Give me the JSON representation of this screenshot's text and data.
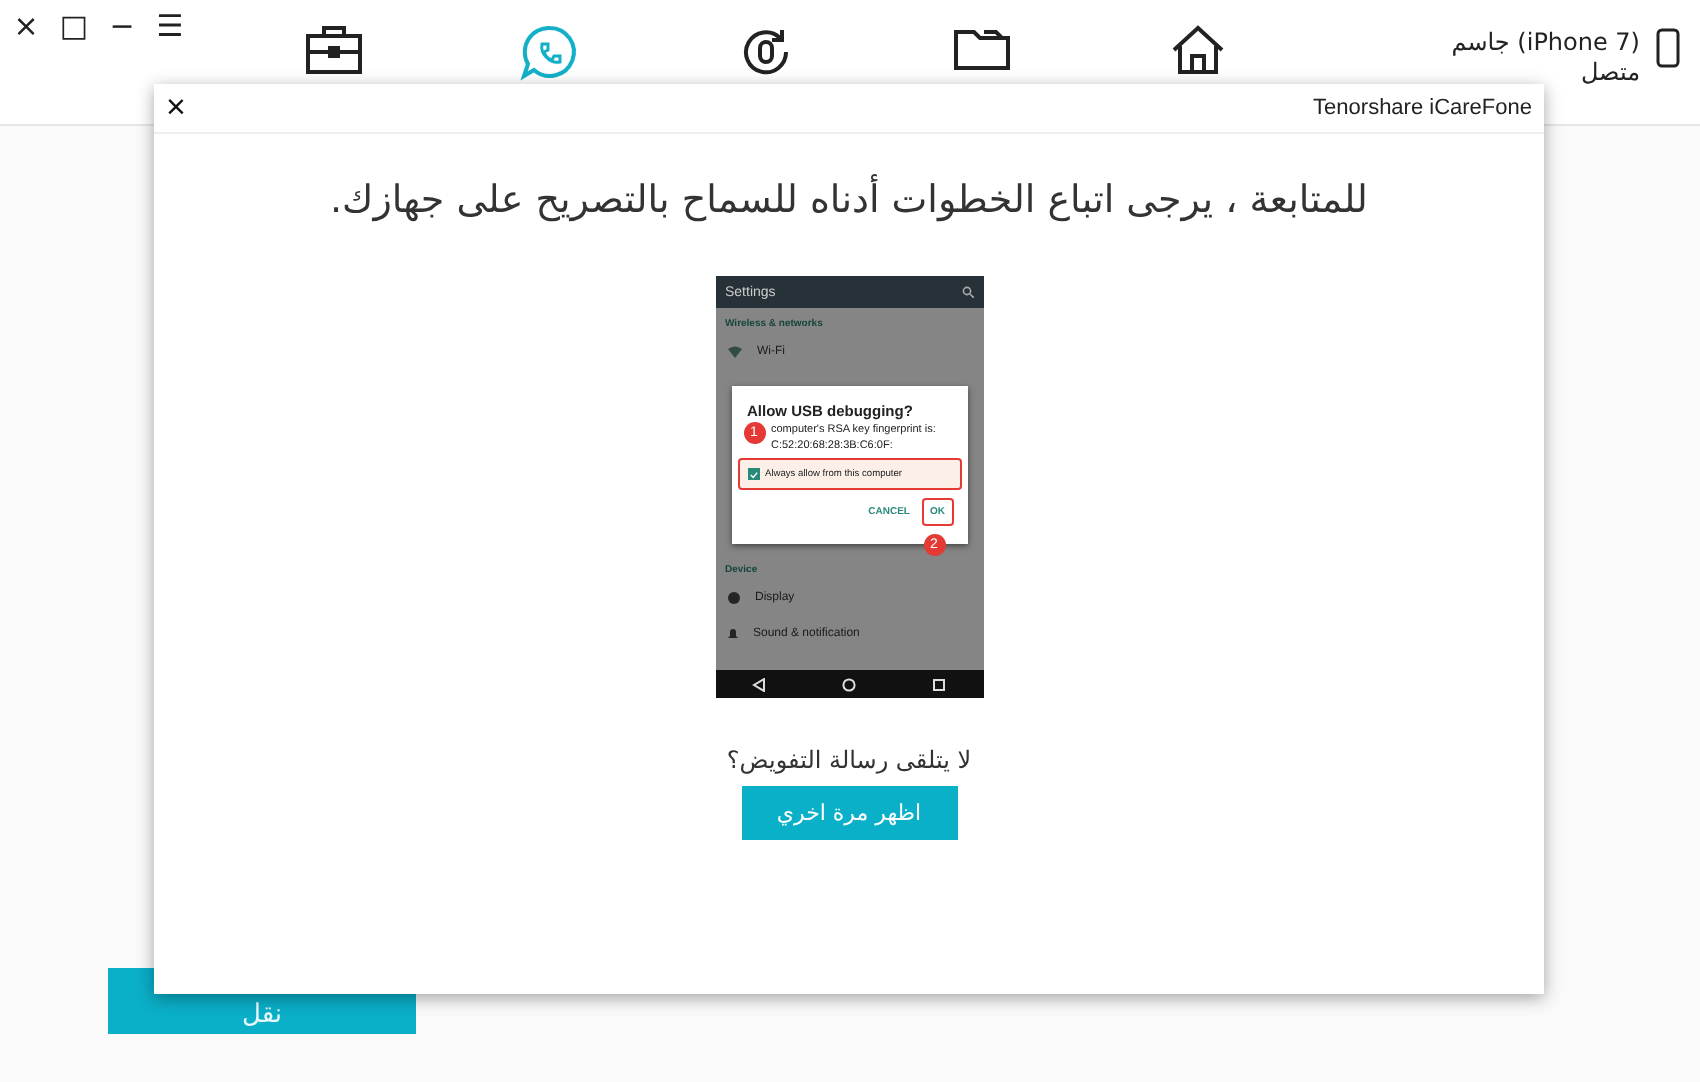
{
  "window_controls": {
    "close": "×",
    "maximize": "□",
    "minimize": "−",
    "menu": "☰"
  },
  "tabs": [
    {
      "kind": "toolbox",
      "selected": false
    },
    {
      "kind": "chat",
      "selected": true
    },
    {
      "kind": "restore",
      "selected": false
    },
    {
      "kind": "folder",
      "selected": false
    },
    {
      "kind": "home",
      "selected": false
    }
  ],
  "device": {
    "name": "جاسم (iPhone 7)",
    "status": "متصل"
  },
  "background_button": {
    "label": "نقل"
  },
  "dialog": {
    "title": "Tenorshare iCareFone",
    "close": "×",
    "heading": "للمتابعة ، يرجى اتباع الخطوات أدناه للسماح بالتصريح على جهازك.",
    "phone": {
      "app_title": "Settings",
      "section_1": "Wireless & networks",
      "item_1": "Wi-Fi",
      "section_2": "Device",
      "item_2": "Display",
      "item_3": "Sound & notification",
      "prompt": {
        "title": "Allow USB debugging?",
        "text": "computer's RSA key fingerprint is:",
        "fingerprint": "C:52:20:68:28:3B:C6:0F:",
        "checkbox": "Always allow from this computer",
        "checked": true,
        "cancel": "CANCEL",
        "ok": "OK"
      },
      "steps": [
        "1",
        "2"
      ]
    },
    "question": "لا يتلقى رسالة التفويض؟",
    "button": "اظهر مرة اخري"
  }
}
